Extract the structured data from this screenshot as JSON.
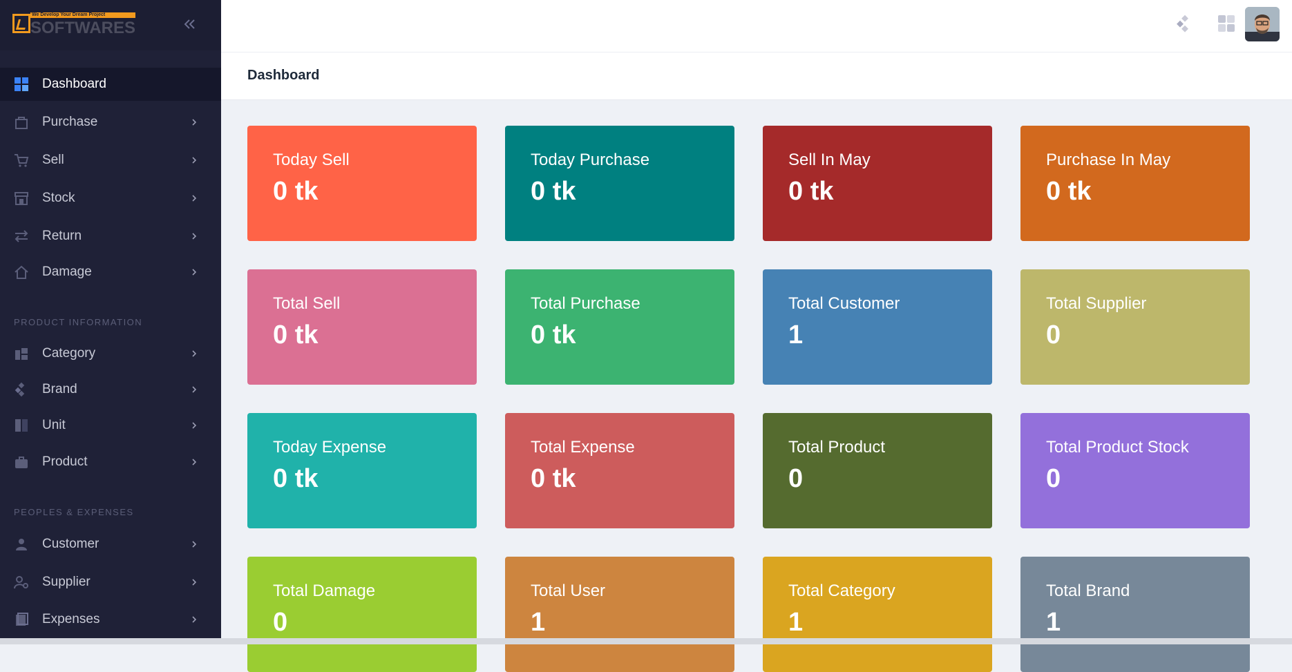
{
  "app": {
    "logo_tagline": "We Develop Your Dream Project",
    "logo_word": "SOFTWARES"
  },
  "sidebar": {
    "items": [
      {
        "label": "Dashboard",
        "icon": "dashboard-icon",
        "active": true
      },
      {
        "label": "Purchase",
        "icon": "bag-icon"
      },
      {
        "label": "Sell",
        "icon": "cart-icon"
      },
      {
        "label": "Stock",
        "icon": "store-icon"
      },
      {
        "label": "Return",
        "icon": "swap-icon"
      },
      {
        "label": "Damage",
        "icon": "home-icon"
      }
    ],
    "section_product": "PRODUCT INFORMATION",
    "product_items": [
      {
        "label": "Category",
        "icon": "category-icon"
      },
      {
        "label": "Brand",
        "icon": "brand-icon"
      },
      {
        "label": "Unit",
        "icon": "unit-icon"
      },
      {
        "label": "Product",
        "icon": "briefcase-icon"
      }
    ],
    "section_people": "PEOPLES & EXPENSES",
    "people_items": [
      {
        "label": "Customer",
        "icon": "person-icon"
      },
      {
        "label": "Supplier",
        "icon": "supplier-icon"
      },
      {
        "label": "Expenses",
        "icon": "expenses-icon"
      }
    ]
  },
  "header": {
    "page_title": "Dashboard"
  },
  "cards": [
    {
      "title": "Today Sell",
      "value": "0 tk",
      "color": "#ff6347"
    },
    {
      "title": "Today Purchase",
      "value": "0 tk",
      "color": "#008080"
    },
    {
      "title": "Sell In May",
      "value": "0 tk",
      "color": "#a52a2a"
    },
    {
      "title": "Purchase In May",
      "value": "0 tk",
      "color": "#d2691e"
    },
    {
      "title": "Total Sell",
      "value": "0 tk",
      "color": "#db7093"
    },
    {
      "title": "Total Purchase",
      "value": "0 tk",
      "color": "#3cb371"
    },
    {
      "title": "Total Customer",
      "value": "1",
      "color": "#4682b4"
    },
    {
      "title": "Total Supplier",
      "value": "0",
      "color": "#bdb76b"
    },
    {
      "title": "Today Expense",
      "value": "0 tk",
      "color": "#20b2aa"
    },
    {
      "title": "Total Expense",
      "value": "0 tk",
      "color": "#cd5c5c"
    },
    {
      "title": "Total Product",
      "value": "0",
      "color": "#556b2f"
    },
    {
      "title": "Total Product Stock",
      "value": "0",
      "color": "#9370db"
    },
    {
      "title": "Total Damage",
      "value": "0",
      "color": "#9acd32"
    },
    {
      "title": "Total User",
      "value": "1",
      "color": "#cd853f"
    },
    {
      "title": "Total Category",
      "value": "1",
      "color": "#daa520"
    },
    {
      "title": "Total Brand",
      "value": "1",
      "color": "#778899"
    }
  ]
}
